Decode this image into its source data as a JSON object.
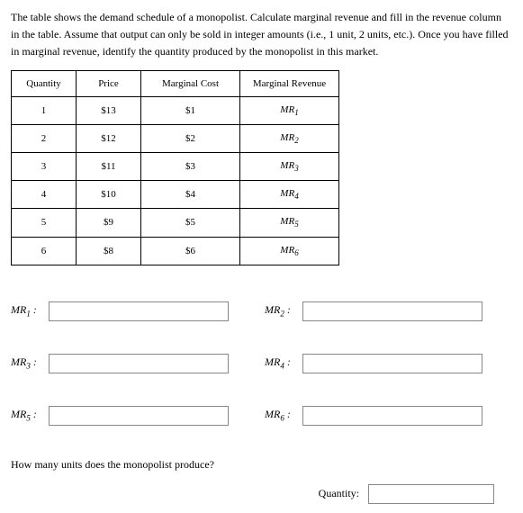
{
  "intro": "The table shows the demand schedule of a monopolist. Calculate marginal revenue and fill in the revenue column in the table. Assume that output can only be sold in integer amounts (i.e., 1 unit, 2 units, etc.). Once you have filled in marginal revenue, identify the quantity produced by the monopolist in this market.",
  "table": {
    "headers": {
      "quantity": "Quantity",
      "price": "Price",
      "mc": "Marginal Cost",
      "mr": "Marginal Revenue"
    },
    "rows": [
      {
        "q": "1",
        "p": "$13",
        "mc": "$1",
        "mr_base": "MR",
        "mr_sub": "1"
      },
      {
        "q": "2",
        "p": "$12",
        "mc": "$2",
        "mr_base": "MR",
        "mr_sub": "2"
      },
      {
        "q": "3",
        "p": "$11",
        "mc": "$3",
        "mr_base": "MR",
        "mr_sub": "3"
      },
      {
        "q": "4",
        "p": "$10",
        "mc": "$4",
        "mr_base": "MR",
        "mr_sub": "4"
      },
      {
        "q": "5",
        "p": "$9",
        "mc": "$5",
        "mr_base": "MR",
        "mr_sub": "5"
      },
      {
        "q": "6",
        "p": "$8",
        "mc": "$6",
        "mr_base": "MR",
        "mr_sub": "6"
      }
    ]
  },
  "inputs": {
    "mr_base": "MR",
    "colon": ":",
    "pairs": [
      {
        "left_sub": "1",
        "right_sub": "2"
      },
      {
        "left_sub": "3",
        "right_sub": "4"
      },
      {
        "left_sub": "5",
        "right_sub": "6"
      }
    ]
  },
  "quantity_question": {
    "prompt": "How many units does the monopolist produce?",
    "label": "Quantity:"
  }
}
